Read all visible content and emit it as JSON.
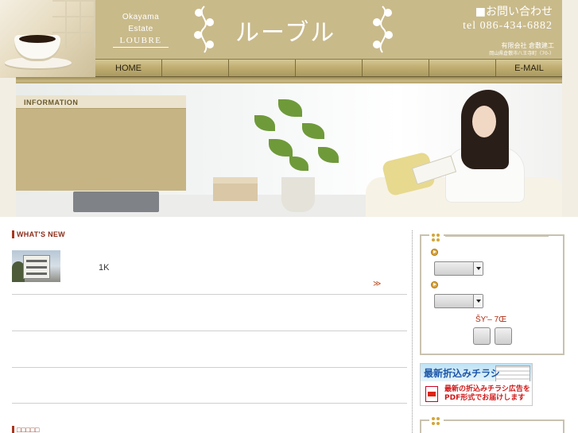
{
  "header": {
    "brand": {
      "line1": "Okayama",
      "line2": "Estate",
      "line3": "LOUBRE"
    },
    "logo": "ルーブル",
    "contact_link": "■お問い合わせ",
    "tel": "tel 086-434-6882",
    "company_name": "有限会社 倉敷建工",
    "company_address": "岡山県倉敷市八王寺町（70-）"
  },
  "nav": {
    "items": [
      {
        "label": "HOME"
      },
      {
        "label": ""
      },
      {
        "label": ""
      },
      {
        "label": ""
      },
      {
        "label": ""
      },
      {
        "label": ""
      },
      {
        "label": "E-MAIL"
      }
    ]
  },
  "info": {
    "title": "INFORMATION"
  },
  "whats_new": {
    "title": "WHAT'S NEW",
    "items": [
      {
        "text": "1K",
        "more": "≫"
      }
    ]
  },
  "sub_section": {
    "title": "□□□□□"
  },
  "search": {
    "select1_value": "",
    "select2_value": "",
    "price_label": "ŠY'– 7Œ",
    "button1": "",
    "button2": ""
  },
  "flyer": {
    "title": "最新折込みチラシ",
    "desc_line1": "最新の折込みチラシ広告を",
    "desc_line2": "PDF形式でお届けします"
  },
  "colors": {
    "banner": "#c9ba8a",
    "accent": "#a9361f",
    "nav_text": "#2a2210"
  }
}
